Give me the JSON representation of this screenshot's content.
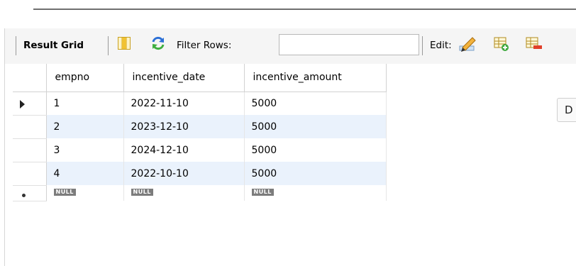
{
  "toolbar": {
    "result_grid_label": "Result Grid",
    "filter_label": "Filter Rows:",
    "filter_value": "",
    "edit_label": "Edit:"
  },
  "grid": {
    "columns": [
      "empno",
      "incentive_date",
      "incentive_amount"
    ],
    "rows": [
      [
        "1",
        "2022-11-10",
        "5000"
      ],
      [
        "2",
        "2023-12-10",
        "5000"
      ],
      [
        "3",
        "2024-12-10",
        "5000"
      ],
      [
        "4",
        "2022-10-10",
        "5000"
      ]
    ],
    "null_label": "NULL"
  },
  "side_tab": {
    "label": "D"
  },
  "icons": {
    "grid_layout": "grid-layout-icon",
    "refresh": "refresh-icon",
    "edit_pencil": "edit-pencil-icon",
    "add_row": "add-row-icon",
    "delete_row": "delete-row-icon",
    "row_pointer": "row-pointer-icon",
    "new_row_marker": "new-row-marker-icon"
  },
  "colors": {
    "alt_row": "#eaf2fc",
    "null_badge": "#7c7c7c",
    "toolbar_bg": "#f5f5f5"
  }
}
